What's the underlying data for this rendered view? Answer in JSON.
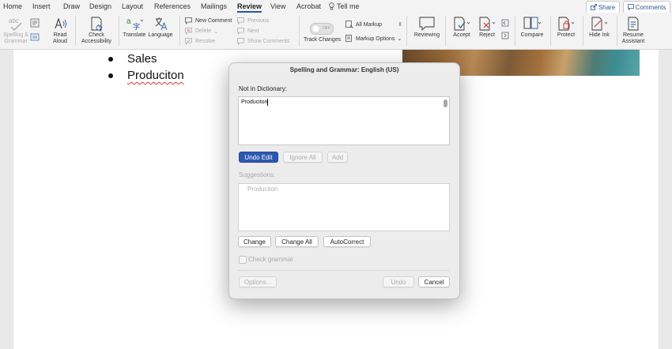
{
  "menu": {
    "tabs": [
      "Home",
      "Insert",
      "Draw",
      "Design",
      "Layout",
      "References",
      "Mailings",
      "Review",
      "View",
      "Acrobat"
    ],
    "active_tab": "Review",
    "tell_me": "Tell me",
    "share": "Share",
    "comments": "Comments"
  },
  "ribbon": {
    "spelling": [
      "Spelling &",
      "Grammar"
    ],
    "read_aloud": [
      "Read",
      "Aloud"
    ],
    "check_accessibility": [
      "Check",
      "Accessibility"
    ],
    "translate": "Translate",
    "language": "Language",
    "new_comment": "New Comment",
    "delete": "Delete",
    "resolve": "Resolve",
    "previous": "Previous",
    "next": "Next",
    "show_comments": "Show Comments",
    "track_changes": "Track Changes",
    "toggle_state": "OFF",
    "all_markup": "All Markup",
    "markup_options": "Markup Options",
    "reviewing": "Reviewing",
    "accept": "Accept",
    "reject": "Reject",
    "compare": "Compare",
    "protect": "Protect",
    "hide_ink": "Hide Ink",
    "resume_assistant": [
      "Resume",
      "Assistant"
    ]
  },
  "document": {
    "bullets": [
      "Sales",
      "Produciton"
    ]
  },
  "dialog": {
    "title": "Spelling and Grammar: English (US)",
    "not_in_dictionary_label": "Not in Dictionary:",
    "not_in_dictionary_value": "Produciton",
    "undo_edit": "Undo Edit",
    "ignore_all": "Ignore All",
    "add": "Add",
    "suggestions_label": "Suggestions:",
    "suggestions": [
      "Production"
    ],
    "change": "Change",
    "change_all": "Change All",
    "autocorrect": "AutoCorrect",
    "check_grammar": "Check grammar",
    "options": "Options...",
    "undo": "Undo",
    "cancel": "Cancel"
  },
  "colors": {
    "accent": "#2c58b0",
    "misspell_underline": "#dd3333"
  }
}
